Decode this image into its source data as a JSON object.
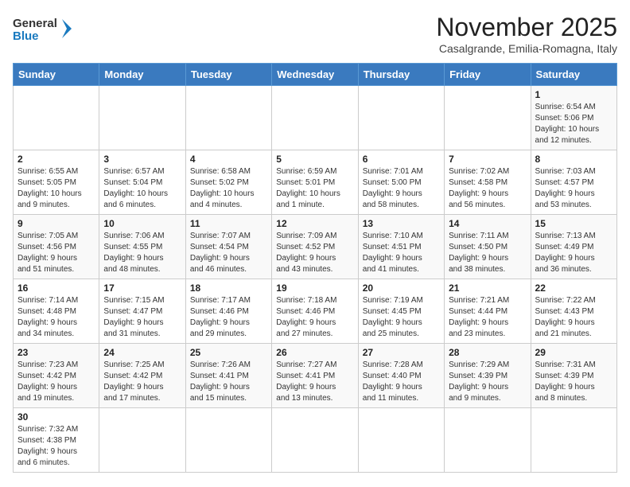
{
  "header": {
    "logo_general": "General",
    "logo_blue": "Blue",
    "month_year": "November 2025",
    "location": "Casalgrande, Emilia-Romagna, Italy"
  },
  "weekdays": [
    "Sunday",
    "Monday",
    "Tuesday",
    "Wednesday",
    "Thursday",
    "Friday",
    "Saturday"
  ],
  "weeks": [
    [
      {
        "day": "",
        "info": ""
      },
      {
        "day": "",
        "info": ""
      },
      {
        "day": "",
        "info": ""
      },
      {
        "day": "",
        "info": ""
      },
      {
        "day": "",
        "info": ""
      },
      {
        "day": "",
        "info": ""
      },
      {
        "day": "1",
        "info": "Sunrise: 6:54 AM\nSunset: 5:06 PM\nDaylight: 10 hours\nand 12 minutes."
      }
    ],
    [
      {
        "day": "2",
        "info": "Sunrise: 6:55 AM\nSunset: 5:05 PM\nDaylight: 10 hours\nand 9 minutes."
      },
      {
        "day": "3",
        "info": "Sunrise: 6:57 AM\nSunset: 5:04 PM\nDaylight: 10 hours\nand 6 minutes."
      },
      {
        "day": "4",
        "info": "Sunrise: 6:58 AM\nSunset: 5:02 PM\nDaylight: 10 hours\nand 4 minutes."
      },
      {
        "day": "5",
        "info": "Sunrise: 6:59 AM\nSunset: 5:01 PM\nDaylight: 10 hours\nand 1 minute."
      },
      {
        "day": "6",
        "info": "Sunrise: 7:01 AM\nSunset: 5:00 PM\nDaylight: 9 hours\nand 58 minutes."
      },
      {
        "day": "7",
        "info": "Sunrise: 7:02 AM\nSunset: 4:58 PM\nDaylight: 9 hours\nand 56 minutes."
      },
      {
        "day": "8",
        "info": "Sunrise: 7:03 AM\nSunset: 4:57 PM\nDaylight: 9 hours\nand 53 minutes."
      }
    ],
    [
      {
        "day": "9",
        "info": "Sunrise: 7:05 AM\nSunset: 4:56 PM\nDaylight: 9 hours\nand 51 minutes."
      },
      {
        "day": "10",
        "info": "Sunrise: 7:06 AM\nSunset: 4:55 PM\nDaylight: 9 hours\nand 48 minutes."
      },
      {
        "day": "11",
        "info": "Sunrise: 7:07 AM\nSunset: 4:54 PM\nDaylight: 9 hours\nand 46 minutes."
      },
      {
        "day": "12",
        "info": "Sunrise: 7:09 AM\nSunset: 4:52 PM\nDaylight: 9 hours\nand 43 minutes."
      },
      {
        "day": "13",
        "info": "Sunrise: 7:10 AM\nSunset: 4:51 PM\nDaylight: 9 hours\nand 41 minutes."
      },
      {
        "day": "14",
        "info": "Sunrise: 7:11 AM\nSunset: 4:50 PM\nDaylight: 9 hours\nand 38 minutes."
      },
      {
        "day": "15",
        "info": "Sunrise: 7:13 AM\nSunset: 4:49 PM\nDaylight: 9 hours\nand 36 minutes."
      }
    ],
    [
      {
        "day": "16",
        "info": "Sunrise: 7:14 AM\nSunset: 4:48 PM\nDaylight: 9 hours\nand 34 minutes."
      },
      {
        "day": "17",
        "info": "Sunrise: 7:15 AM\nSunset: 4:47 PM\nDaylight: 9 hours\nand 31 minutes."
      },
      {
        "day": "18",
        "info": "Sunrise: 7:17 AM\nSunset: 4:46 PM\nDaylight: 9 hours\nand 29 minutes."
      },
      {
        "day": "19",
        "info": "Sunrise: 7:18 AM\nSunset: 4:46 PM\nDaylight: 9 hours\nand 27 minutes."
      },
      {
        "day": "20",
        "info": "Sunrise: 7:19 AM\nSunset: 4:45 PM\nDaylight: 9 hours\nand 25 minutes."
      },
      {
        "day": "21",
        "info": "Sunrise: 7:21 AM\nSunset: 4:44 PM\nDaylight: 9 hours\nand 23 minutes."
      },
      {
        "day": "22",
        "info": "Sunrise: 7:22 AM\nSunset: 4:43 PM\nDaylight: 9 hours\nand 21 minutes."
      }
    ],
    [
      {
        "day": "23",
        "info": "Sunrise: 7:23 AM\nSunset: 4:42 PM\nDaylight: 9 hours\nand 19 minutes."
      },
      {
        "day": "24",
        "info": "Sunrise: 7:25 AM\nSunset: 4:42 PM\nDaylight: 9 hours\nand 17 minutes."
      },
      {
        "day": "25",
        "info": "Sunrise: 7:26 AM\nSunset: 4:41 PM\nDaylight: 9 hours\nand 15 minutes."
      },
      {
        "day": "26",
        "info": "Sunrise: 7:27 AM\nSunset: 4:41 PM\nDaylight: 9 hours\nand 13 minutes."
      },
      {
        "day": "27",
        "info": "Sunrise: 7:28 AM\nSunset: 4:40 PM\nDaylight: 9 hours\nand 11 minutes."
      },
      {
        "day": "28",
        "info": "Sunrise: 7:29 AM\nSunset: 4:39 PM\nDaylight: 9 hours\nand 9 minutes."
      },
      {
        "day": "29",
        "info": "Sunrise: 7:31 AM\nSunset: 4:39 PM\nDaylight: 9 hours\nand 8 minutes."
      }
    ],
    [
      {
        "day": "30",
        "info": "Sunrise: 7:32 AM\nSunset: 4:38 PM\nDaylight: 9 hours\nand 6 minutes."
      },
      {
        "day": "",
        "info": ""
      },
      {
        "day": "",
        "info": ""
      },
      {
        "day": "",
        "info": ""
      },
      {
        "day": "",
        "info": ""
      },
      {
        "day": "",
        "info": ""
      },
      {
        "day": "",
        "info": ""
      }
    ]
  ]
}
